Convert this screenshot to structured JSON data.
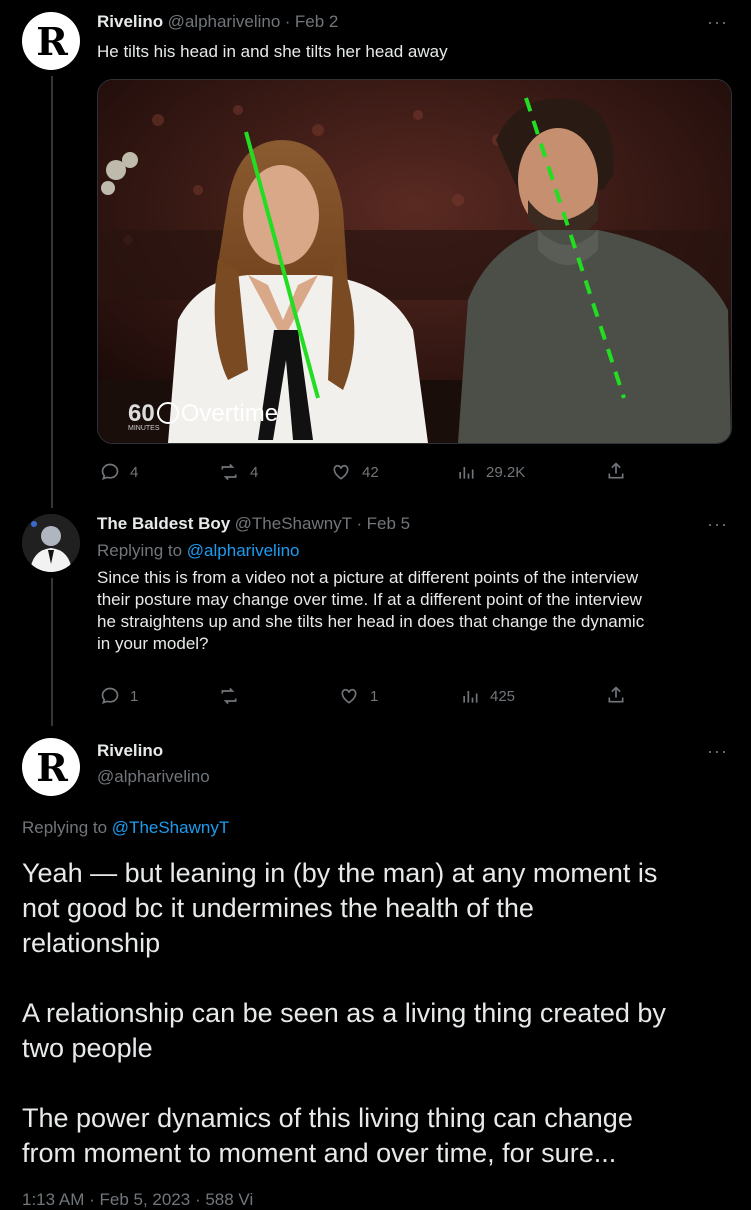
{
  "tweet1": {
    "avatar_letter": "R",
    "name": "Rivelino",
    "handle": "@alpharivelino",
    "dot": "·",
    "date": "Feb 2",
    "text": "He tilts his head in and she tilts her head away",
    "media_watermark": "60",
    "media_watermark_sub": "MINUTES",
    "media_watermark_word": "Overtime",
    "actions": {
      "replies": "4",
      "retweets": "4",
      "likes": "42",
      "views": "29.2K"
    }
  },
  "tweet2": {
    "name": "The Baldest Boy",
    "handle": "@TheShawnyT",
    "dot": "·",
    "date": "Feb 5",
    "replying_prefix": "Replying to",
    "replying_to": "@alpharivelino",
    "text_lines": [
      "Since this is from a video not a picture at different points of the interview",
      "their posture may change over time. If at a different point of the interview",
      "he straightens up and she tilts her head in does that change the dynamic",
      "in your model?"
    ],
    "actions": {
      "replies": "1",
      "retweets": "",
      "likes": "1",
      "views": "425"
    }
  },
  "tweet3": {
    "avatar_letter": "R",
    "name": "Rivelino",
    "handle": "@alpharivelino",
    "replying_prefix": "Replying to",
    "replying_to": "@TheShawnyT",
    "paragraphs": [
      [
        "Yeah — but leaning in (by the man) at any moment is",
        "not good bc it undermines the health of the",
        "relationship"
      ],
      [
        "A relationship can be seen as a living thing created by",
        "two people"
      ],
      [
        "The power dynamics of this living thing can change",
        "from moment to moment and over time, for sure..."
      ]
    ],
    "footer_partial": "1:13 AM · Feb 5, 2023 · 588 Vi"
  },
  "colors": {
    "background": "#000000",
    "text": "#e7e9ea",
    "muted": "#71767b",
    "link": "#1d9bf0",
    "annotation_line": "#22dd22"
  },
  "icons": [
    "reply-icon",
    "retweet-icon",
    "like-icon",
    "views-icon",
    "share-icon",
    "more-icon"
  ],
  "more_label": "···"
}
